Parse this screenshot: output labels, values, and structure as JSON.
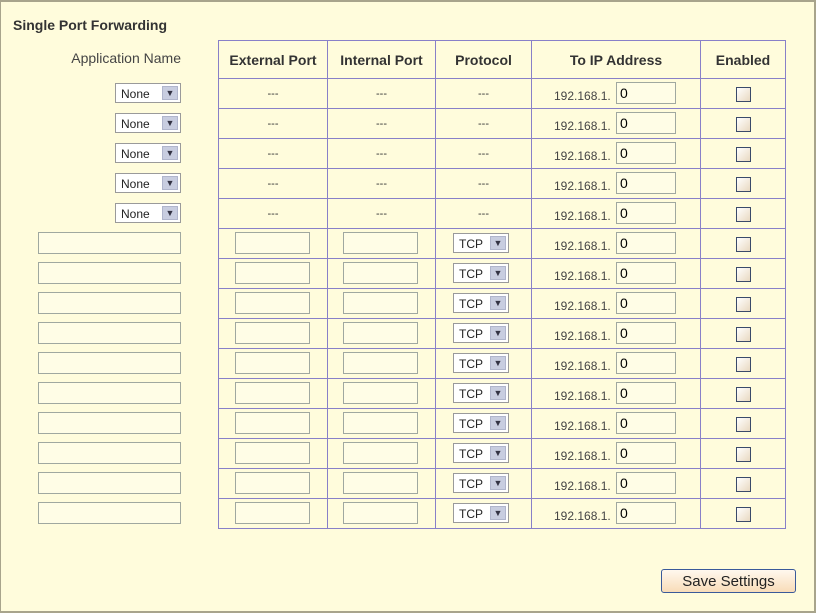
{
  "title": "Single Port Forwarding",
  "headers": {
    "app": "Application Name",
    "ext": "External Port",
    "int": "Internal Port",
    "proto": "Protocol",
    "ip": "To IP Address",
    "en": "Enabled"
  },
  "preset_rows": [
    {
      "app": "None",
      "ext": "---",
      "int": "---",
      "proto": "---",
      "ip_prefix": "192.168.1.",
      "ip_last": "0",
      "enabled": false
    },
    {
      "app": "None",
      "ext": "---",
      "int": "---",
      "proto": "---",
      "ip_prefix": "192.168.1.",
      "ip_last": "0",
      "enabled": false
    },
    {
      "app": "None",
      "ext": "---",
      "int": "---",
      "proto": "---",
      "ip_prefix": "192.168.1.",
      "ip_last": "0",
      "enabled": false
    },
    {
      "app": "None",
      "ext": "---",
      "int": "---",
      "proto": "---",
      "ip_prefix": "192.168.1.",
      "ip_last": "0",
      "enabled": false
    },
    {
      "app": "None",
      "ext": "---",
      "int": "---",
      "proto": "---",
      "ip_prefix": "192.168.1.",
      "ip_last": "0",
      "enabled": false
    }
  ],
  "custom_rows": [
    {
      "app": "",
      "ext": "",
      "int": "",
      "proto": "TCP",
      "ip_prefix": "192.168.1.",
      "ip_last": "0",
      "enabled": false
    },
    {
      "app": "",
      "ext": "",
      "int": "",
      "proto": "TCP",
      "ip_prefix": "192.168.1.",
      "ip_last": "0",
      "enabled": false
    },
    {
      "app": "",
      "ext": "",
      "int": "",
      "proto": "TCP",
      "ip_prefix": "192.168.1.",
      "ip_last": "0",
      "enabled": false
    },
    {
      "app": "",
      "ext": "",
      "int": "",
      "proto": "TCP",
      "ip_prefix": "192.168.1.",
      "ip_last": "0",
      "enabled": false
    },
    {
      "app": "",
      "ext": "",
      "int": "",
      "proto": "TCP",
      "ip_prefix": "192.168.1.",
      "ip_last": "0",
      "enabled": false
    },
    {
      "app": "",
      "ext": "",
      "int": "",
      "proto": "TCP",
      "ip_prefix": "192.168.1.",
      "ip_last": "0",
      "enabled": false
    },
    {
      "app": "",
      "ext": "",
      "int": "",
      "proto": "TCP",
      "ip_prefix": "192.168.1.",
      "ip_last": "0",
      "enabled": false
    },
    {
      "app": "",
      "ext": "",
      "int": "",
      "proto": "TCP",
      "ip_prefix": "192.168.1.",
      "ip_last": "0",
      "enabled": false
    },
    {
      "app": "",
      "ext": "",
      "int": "",
      "proto": "TCP",
      "ip_prefix": "192.168.1.",
      "ip_last": "0",
      "enabled": false
    },
    {
      "app": "",
      "ext": "",
      "int": "",
      "proto": "TCP",
      "ip_prefix": "192.168.1.",
      "ip_last": "0",
      "enabled": false
    }
  ],
  "save_label": "Save Settings"
}
